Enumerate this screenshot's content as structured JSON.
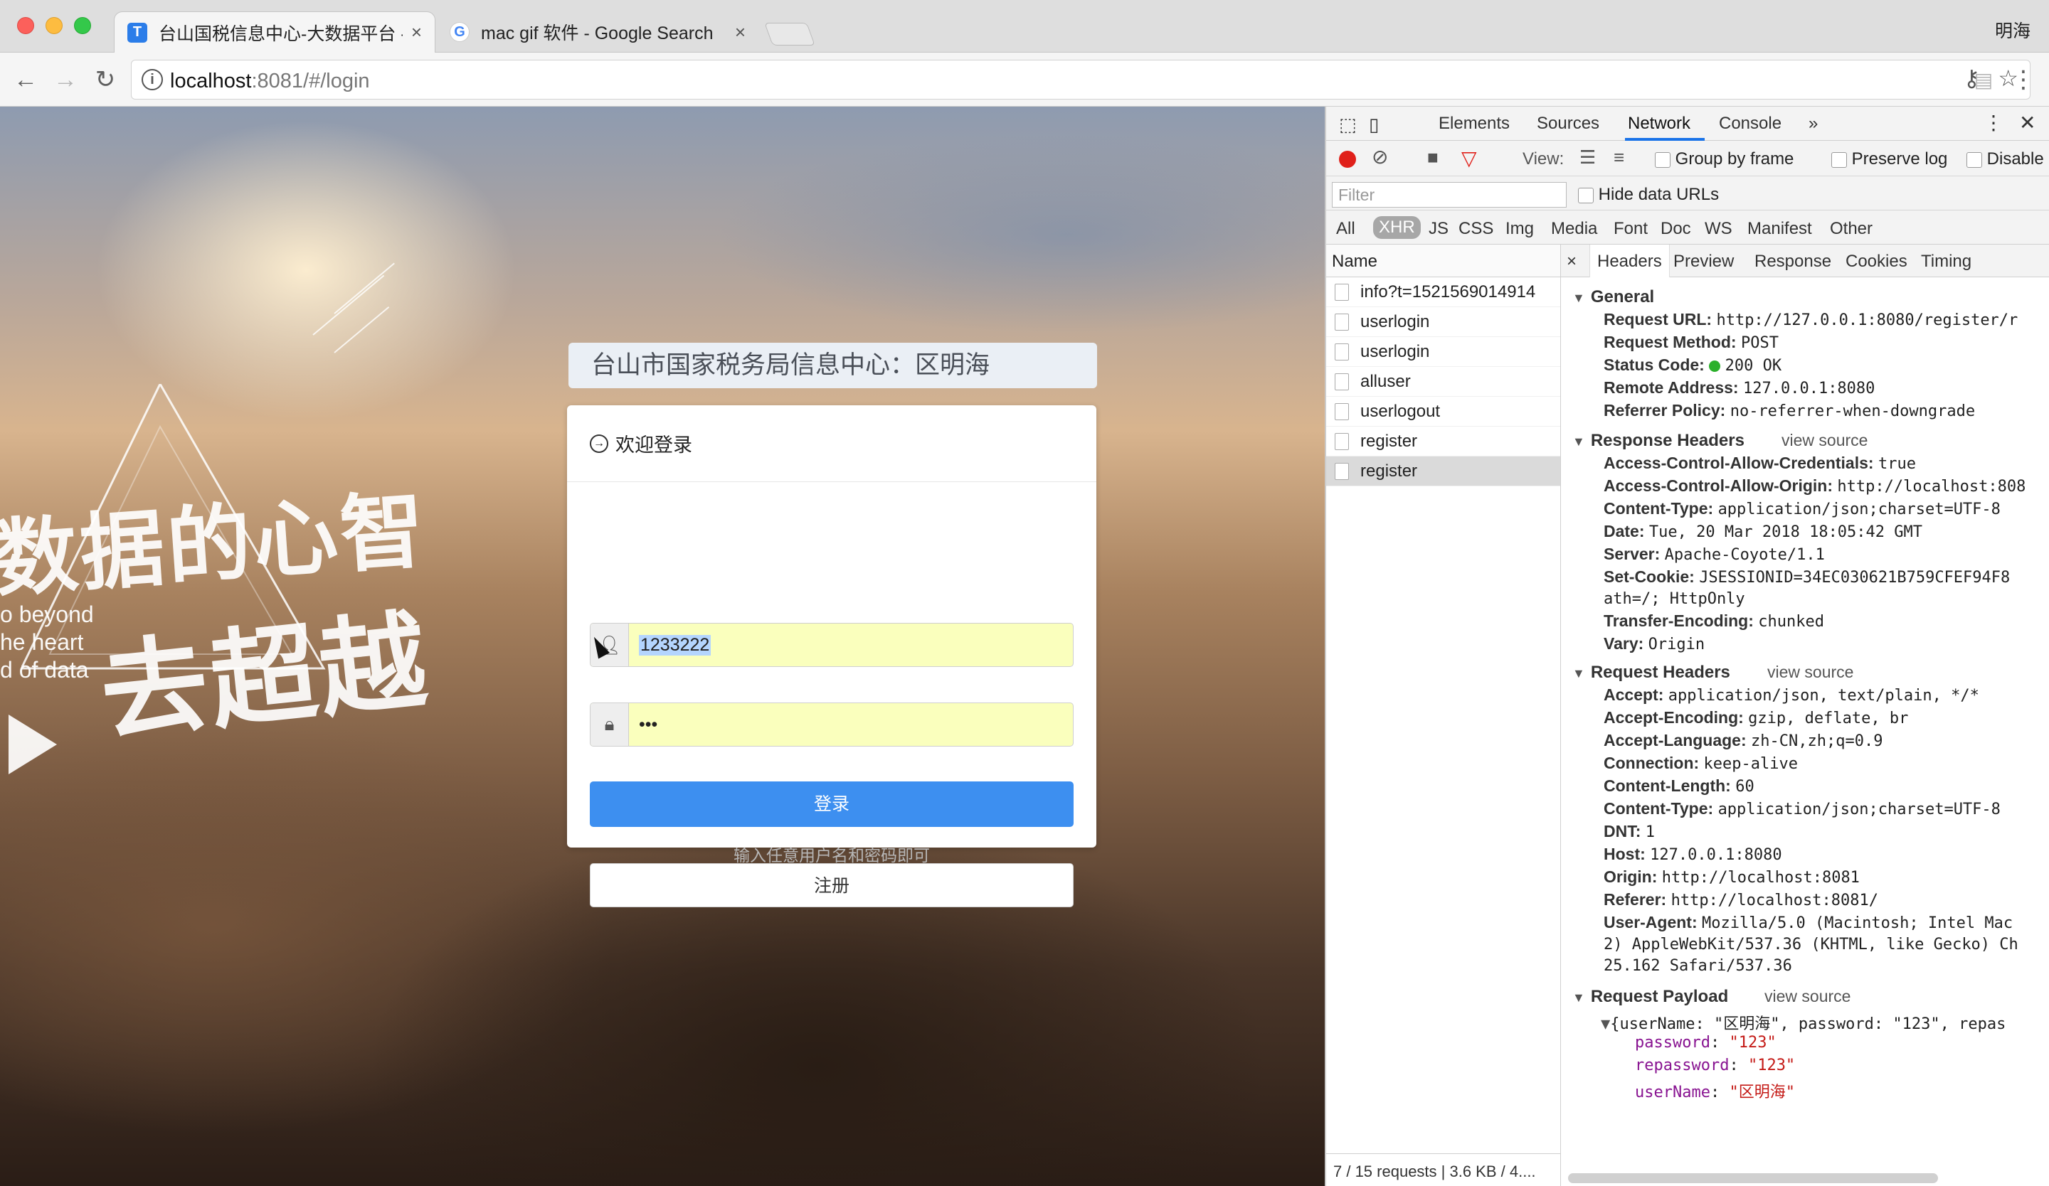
{
  "window": {
    "user_name": "明海",
    "tabs": [
      {
        "title": "台山国税信息中心-大数据平台 -",
        "favicon_letter": "T",
        "favicon_color": "#2b7de9"
      },
      {
        "title": "mac gif 软件 - Google Search",
        "favicon_letter": "G"
      }
    ],
    "close_glyph": "×"
  },
  "toolbar": {
    "url_host": "localhost",
    "url_rest": ":8081/#/login"
  },
  "page": {
    "calligraphy_line1": "数据的心智",
    "calligraphy_line2": "去超越",
    "slogan_lines": [
      "o beyond",
      "he heart",
      "d of data"
    ],
    "headline": "台山市国家税务局信息中心：区明海",
    "panel_title": "欢迎登录",
    "username_value": "1233222",
    "password_value": "•••",
    "login_label": "登录",
    "hint": "输入任意用户名和密码即可",
    "register_label": "注册",
    "accent_color": "#3d8ff0"
  },
  "devtools": {
    "tabs": [
      "Elements",
      "Sources",
      "Network",
      "Console"
    ],
    "active_tab": "Network",
    "more": "»",
    "view_label": "View:",
    "group_by_frame": "Group by frame",
    "preserve_log": "Preserve log",
    "disable_cache": "Disable",
    "filter_placeholder": "Filter",
    "hide_data_urls": "Hide data URLs",
    "filter_types": [
      "All",
      "XHR",
      "JS",
      "CSS",
      "Img",
      "Media",
      "Font",
      "Doc",
      "WS",
      "Manifest",
      "Other"
    ],
    "selected_filter": "XHR",
    "name_header": "Name",
    "requests": [
      "info?t=1521569014914",
      "userlogin",
      "userlogin",
      "alluser",
      "userlogout",
      "register",
      "register"
    ],
    "selected_request_index": 6,
    "summary": "7 / 15 requests | 3.6 KB / 4....",
    "detail_tabs": [
      "Headers",
      "Preview",
      "Response",
      "Cookies",
      "Timing"
    ],
    "active_detail_tab": "Headers",
    "view_source": "view source",
    "general": {
      "title": "General",
      "rows": [
        {
          "k": "Request URL:",
          "v": "http://127.0.0.1:8080/register/r"
        },
        {
          "k": "Request Method:",
          "v": "POST"
        },
        {
          "k": "Status Code:",
          "v": "200 OK"
        },
        {
          "k": "Remote Address:",
          "v": "127.0.0.1:8080"
        },
        {
          "k": "Referrer Policy:",
          "v": "no-referrer-when-downgrade"
        }
      ]
    },
    "response_headers": {
      "title": "Response Headers",
      "rows": [
        {
          "k": "Access-Control-Allow-Credentials:",
          "v": "true"
        },
        {
          "k": "Access-Control-Allow-Origin:",
          "v": "http://localhost:808"
        },
        {
          "k": "Content-Type:",
          "v": "application/json;charset=UTF-8"
        },
        {
          "k": "Date:",
          "v": "Tue, 20 Mar 2018 18:05:42 GMT"
        },
        {
          "k": "Server:",
          "v": "Apache-Coyote/1.1"
        },
        {
          "k": "Set-Cookie:",
          "v": "JSESSIONID=34EC030621B759CFEF94F8"
        },
        {
          "k": "",
          "v": "ath=/; HttpOnly"
        },
        {
          "k": "Transfer-Encoding:",
          "v": "chunked"
        },
        {
          "k": "Vary:",
          "v": "Origin"
        }
      ]
    },
    "request_headers": {
      "title": "Request Headers",
      "rows": [
        {
          "k": "Accept:",
          "v": "application/json, text/plain, */*"
        },
        {
          "k": "Accept-Encoding:",
          "v": "gzip, deflate, br"
        },
        {
          "k": "Accept-Language:",
          "v": "zh-CN,zh;q=0.9"
        },
        {
          "k": "Connection:",
          "v": "keep-alive"
        },
        {
          "k": "Content-Length:",
          "v": "60"
        },
        {
          "k": "Content-Type:",
          "v": "application/json;charset=UTF-8"
        },
        {
          "k": "DNT:",
          "v": "1"
        },
        {
          "k": "Host:",
          "v": "127.0.0.1:8080"
        },
        {
          "k": "Origin:",
          "v": "http://localhost:8081"
        },
        {
          "k": "Referer:",
          "v": "http://localhost:8081/"
        },
        {
          "k": "User-Agent:",
          "v": "Mozilla/5.0 (Macintosh; Intel Mac"
        },
        {
          "k": "",
          "v": "2) AppleWebKit/537.36 (KHTML, like Gecko) Ch"
        },
        {
          "k": "",
          "v": "25.162 Safari/537.36"
        }
      ]
    },
    "payload": {
      "title": "Request Payload",
      "summary": "{userName: \"区明海\", password: \"123\", repas",
      "fields": [
        {
          "k": "password",
          "v": "\"123\""
        },
        {
          "k": "repassword",
          "v": "\"123\""
        },
        {
          "k": "userName",
          "v": "\"区明海\""
        }
      ]
    }
  }
}
